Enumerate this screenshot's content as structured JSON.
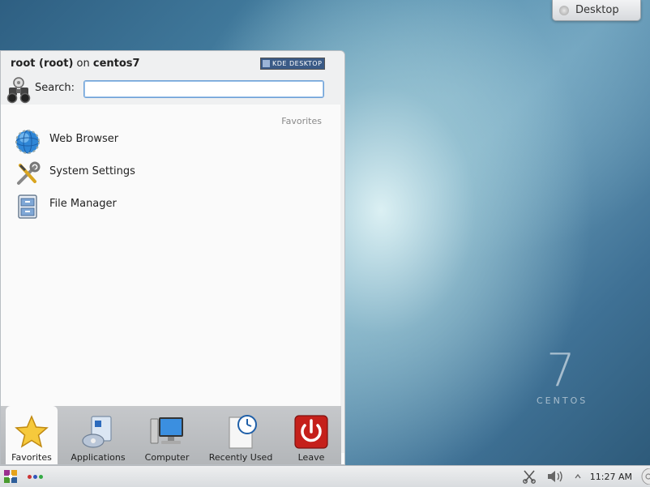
{
  "desktop": {
    "os_number": "7",
    "os_name": "CENTOS",
    "toolbox_label": "Desktop"
  },
  "menu": {
    "user_name": "root (root)",
    "user_on": "on",
    "host": "centos7",
    "kde_badge": "KDE DESKTOP",
    "search_label": "Search:",
    "search_value": "",
    "favorites_header": "Favorites",
    "favorites": [
      {
        "label": "Web Browser",
        "icon": "globe-icon"
      },
      {
        "label": "System Settings",
        "icon": "tools-icon"
      },
      {
        "label": "File Manager",
        "icon": "file-cabinet-icon"
      }
    ],
    "tabs": [
      {
        "label": "Favorites",
        "icon": "star-icon"
      },
      {
        "label": "Applications",
        "icon": "applications-icon"
      },
      {
        "label": "Computer",
        "icon": "computer-icon"
      },
      {
        "label": "Recently Used",
        "icon": "clock-icon"
      },
      {
        "label": "Leave",
        "icon": "power-icon"
      }
    ],
    "active_tab": "Favorites"
  },
  "taskbar": {
    "clock": "11:27 AM",
    "pager_colors": [
      "#cc3333",
      "#3355bb",
      "#33aa44"
    ]
  }
}
